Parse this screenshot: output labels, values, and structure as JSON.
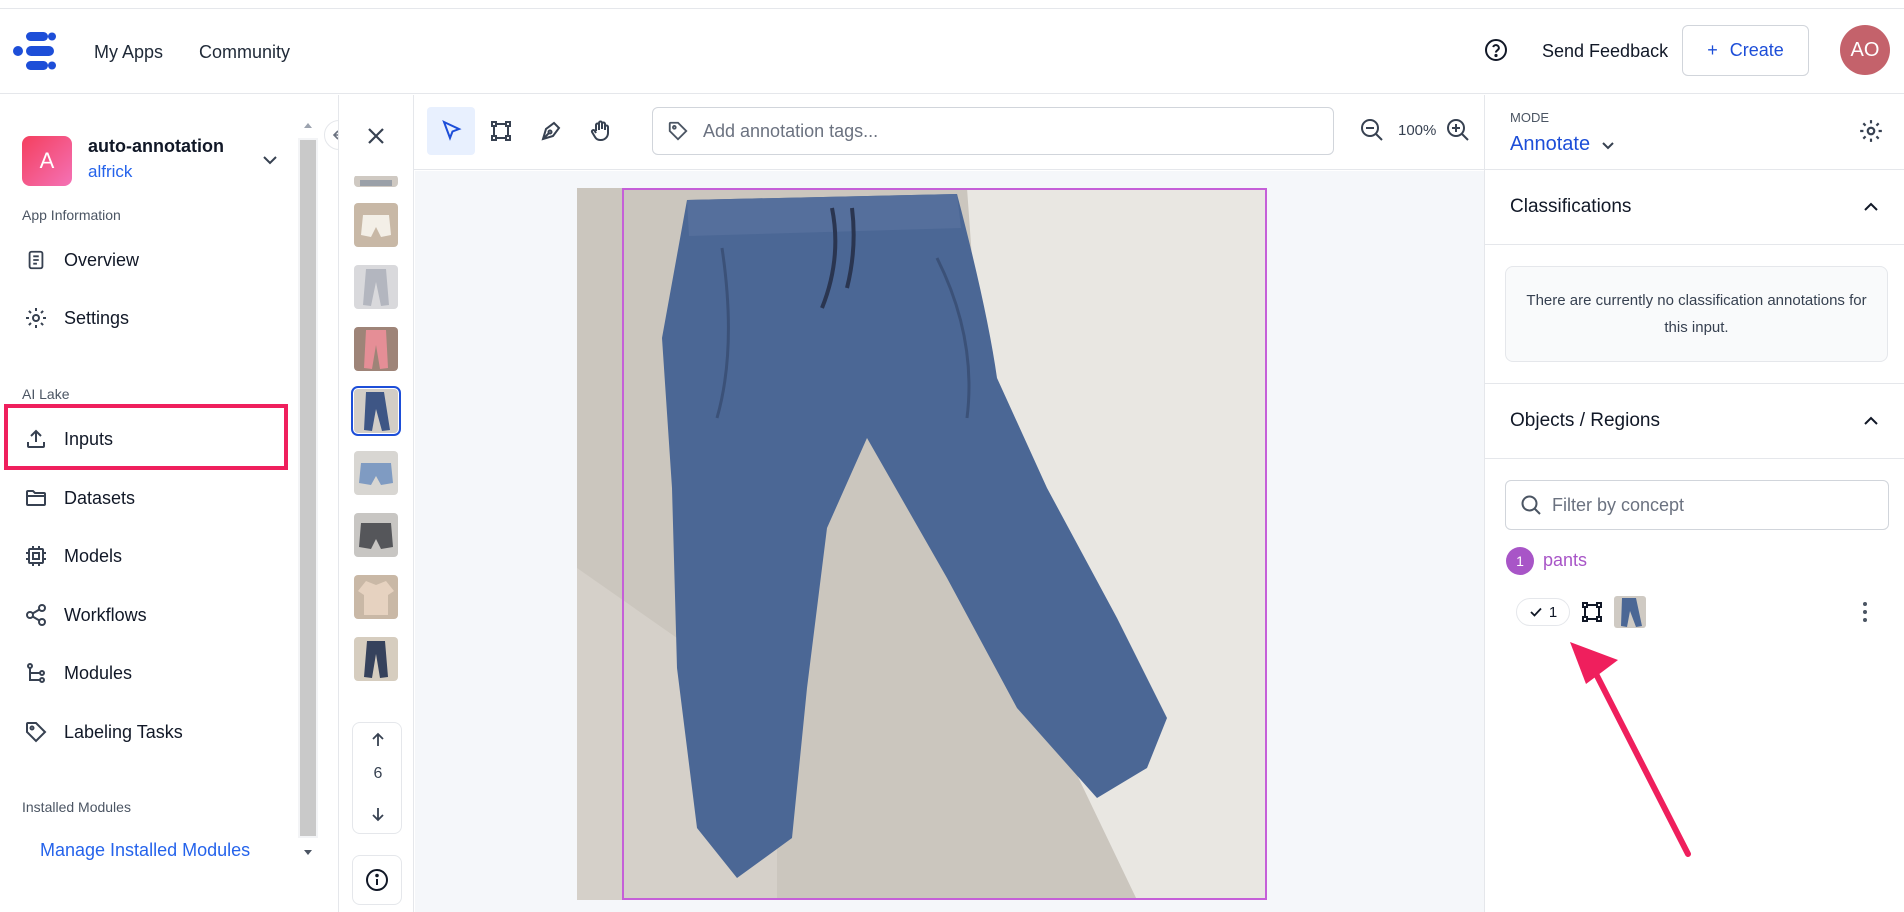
{
  "header": {
    "nav": [
      "My Apps",
      "Community"
    ],
    "help_icon": "help-circle-icon",
    "feedback_label": "Send Feedback",
    "create_label": "Create",
    "avatar_initials": "AO"
  },
  "sidebar": {
    "app": {
      "badge": "A",
      "name": "auto-annotation",
      "user": "alfrick"
    },
    "sections": {
      "app_info": "App Information",
      "ai_lake": "AI Lake",
      "installed": "Installed Modules"
    },
    "items": [
      {
        "label": "Overview",
        "icon": "document-icon"
      },
      {
        "label": "Settings",
        "icon": "gear-icon"
      },
      {
        "label": "Inputs",
        "icon": "upload-icon"
      },
      {
        "label": "Datasets",
        "icon": "folder-icon"
      },
      {
        "label": "Models",
        "icon": "chip-icon"
      },
      {
        "label": "Workflows",
        "icon": "share-icon"
      },
      {
        "label": "Modules",
        "icon": "hierarchy-icon"
      },
      {
        "label": "Labeling Tasks",
        "icon": "tag-icon"
      }
    ],
    "manage_label": "Manage Installed Modules",
    "highlighted_item": "Inputs"
  },
  "thumbnails": {
    "selected_index": 3,
    "items": [
      "shorts",
      "grey-pants",
      "pink-pants",
      "blue-pants",
      "denim-shorts",
      "dark-shorts",
      "beige-shirt",
      "navy-pants"
    ],
    "page": "6"
  },
  "toolbar": {
    "tools": [
      "select-tool",
      "bounding-box-tool",
      "polygon-pen-tool",
      "pan-hand-tool"
    ],
    "active_tool": "select-tool",
    "tags_placeholder": "Add annotation tags...",
    "zoom_level": "100%"
  },
  "right_panel": {
    "mode_label": "MODE",
    "mode_value": "Annotate",
    "classifications_title": "Classifications",
    "classifications_empty": "There are currently no classification annotations for this input.",
    "objects_title": "Objects / Regions",
    "filter_placeholder": "Filter by concept",
    "concepts": [
      {
        "index": "1",
        "name": "pants",
        "count": "1",
        "color": "#a855c7"
      }
    ]
  },
  "colors": {
    "accent": "#1d4ed8",
    "highlight": "#ef1f5d",
    "concept": "#a855c7"
  }
}
